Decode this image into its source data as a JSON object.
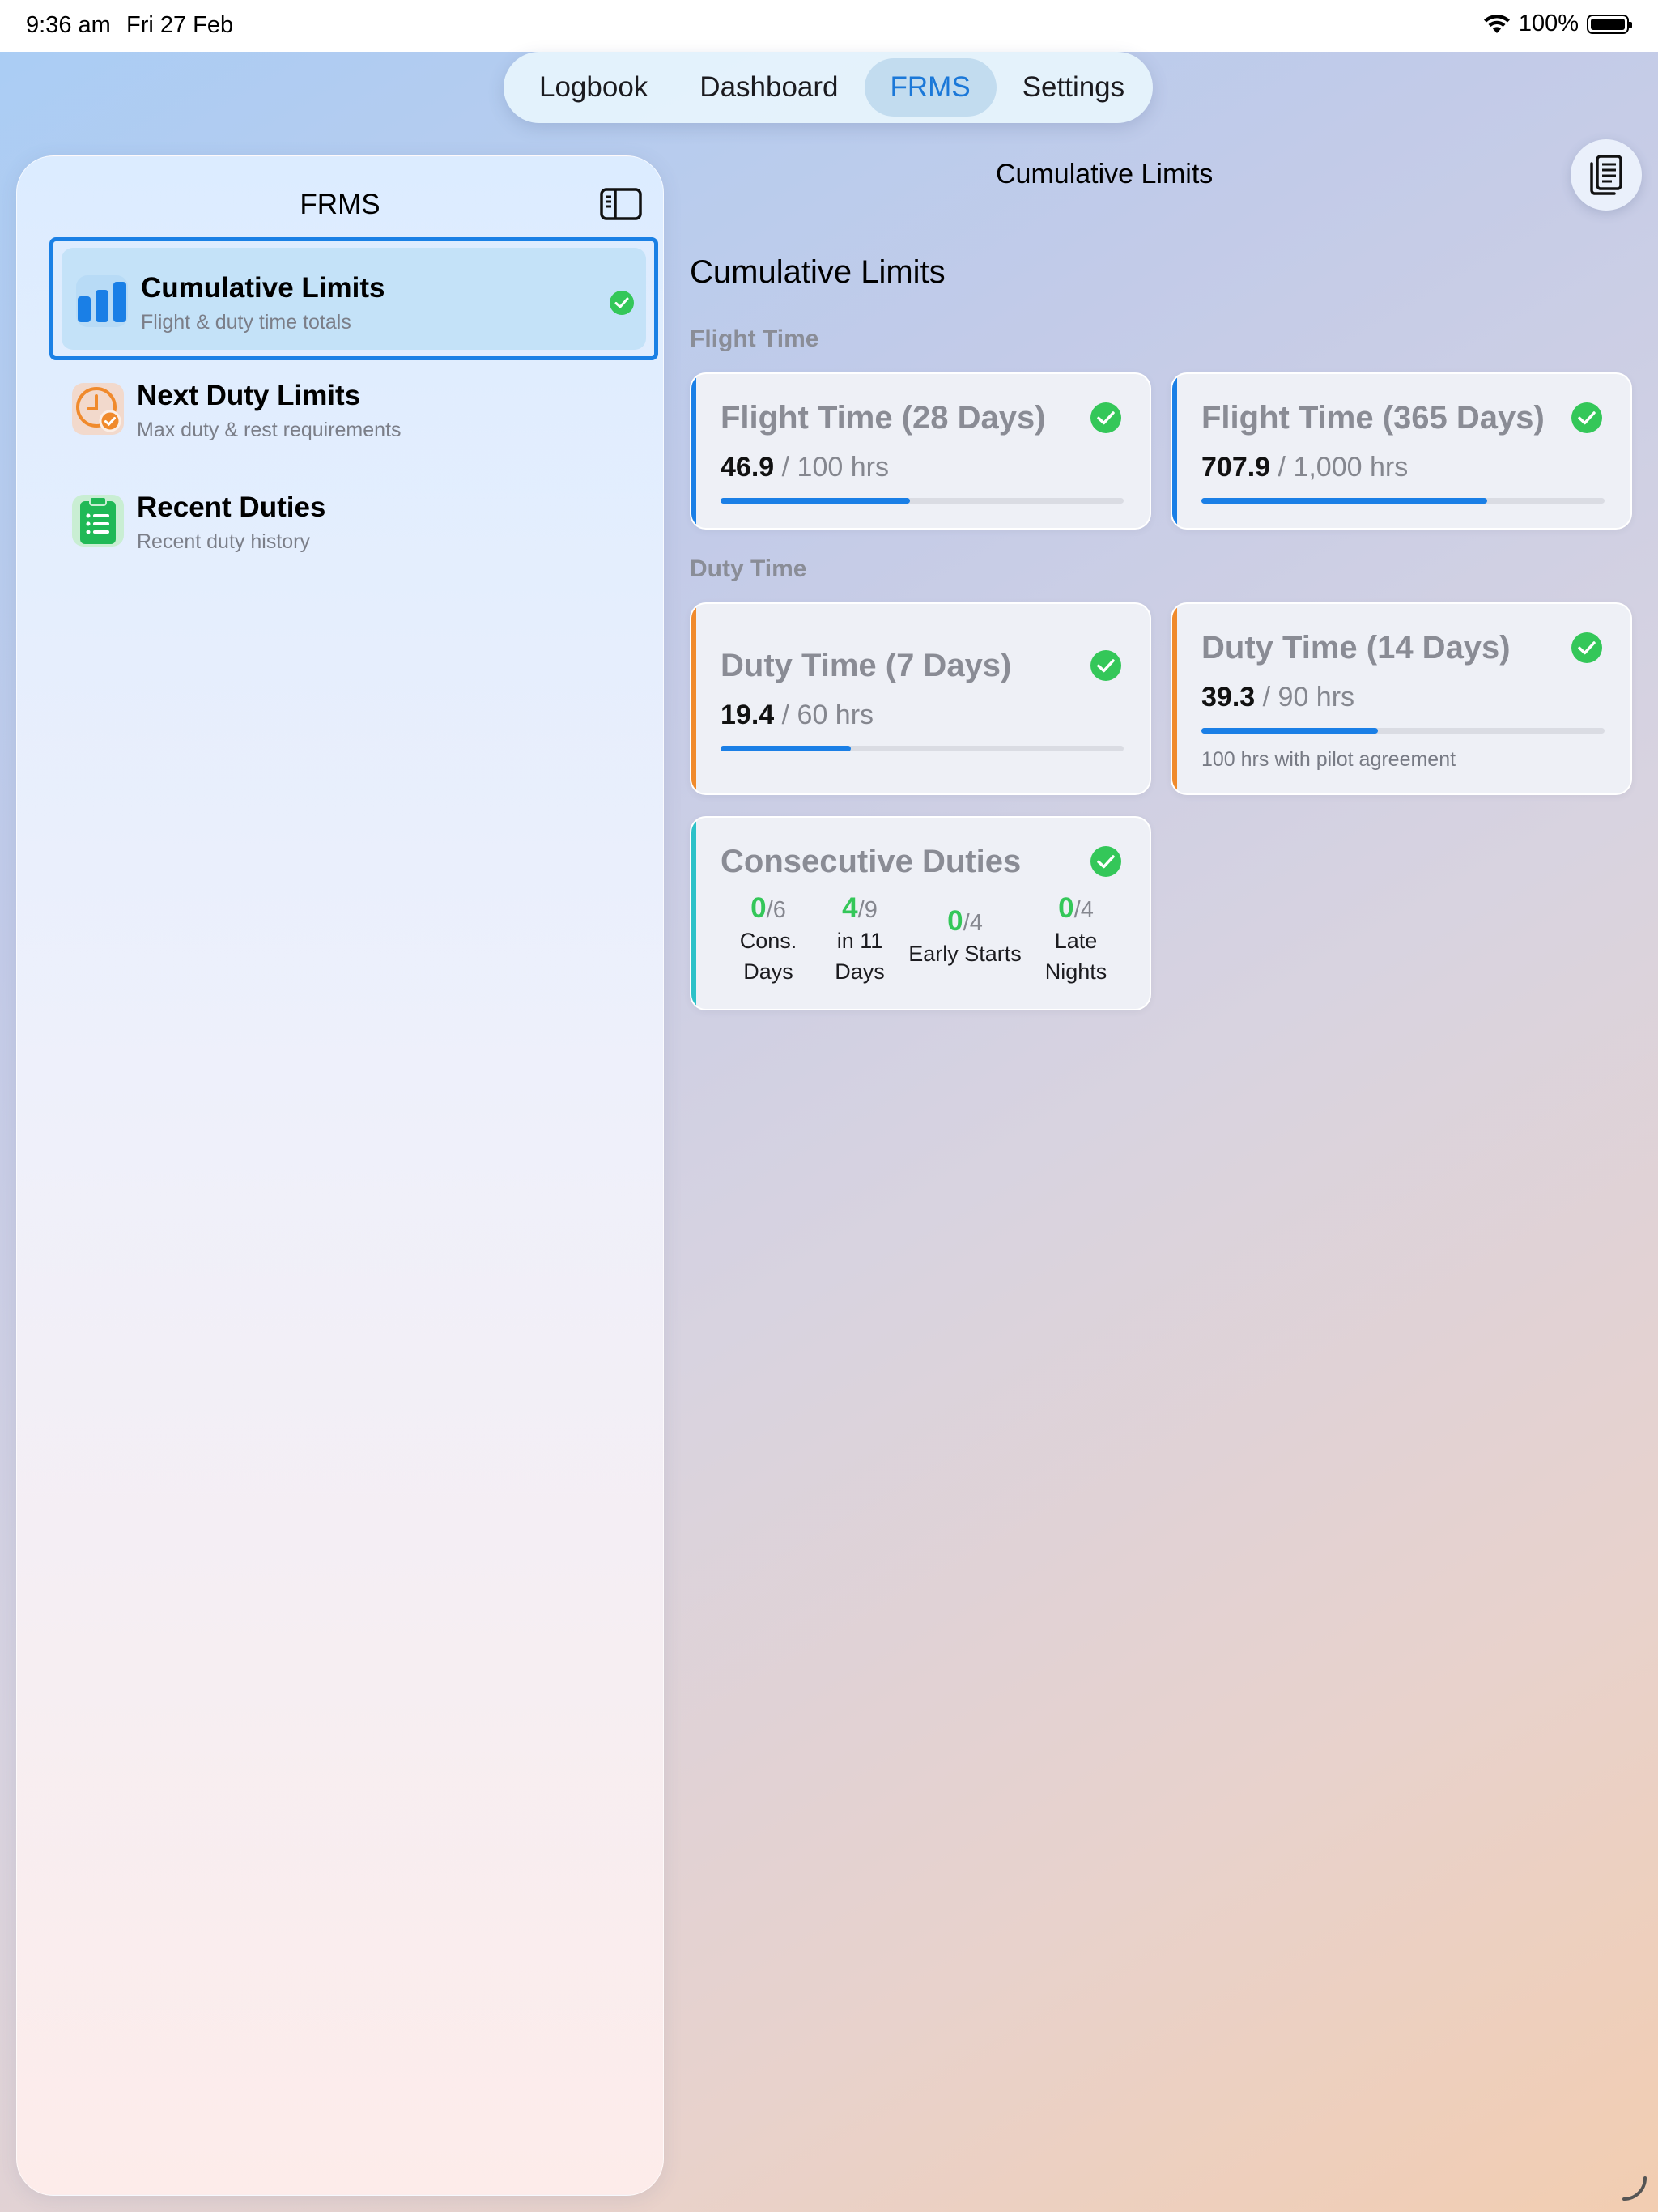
{
  "status": {
    "time": "9:36 am",
    "date": "Fri 27 Feb",
    "battery": "100%"
  },
  "tabs": [
    {
      "label": "Logbook",
      "active": false
    },
    {
      "label": "Dashboard",
      "active": false
    },
    {
      "label": "FRMS",
      "active": true
    },
    {
      "label": "Settings",
      "active": false
    }
  ],
  "sidebar": {
    "title": "FRMS",
    "items": [
      {
        "title": "Cumulative Limits",
        "subtitle": "Flight & duty time totals",
        "icon": "bar-chart-icon",
        "selected": true
      },
      {
        "title": "Next Duty Limits",
        "subtitle": "Max duty & rest requirements",
        "icon": "clock-badge-icon",
        "selected": false
      },
      {
        "title": "Recent Duties",
        "subtitle": "Recent duty history",
        "icon": "clipboard-icon",
        "selected": false
      }
    ]
  },
  "main": {
    "nav_title": "Cumulative Limits",
    "heading": "Cumulative Limits",
    "sections": {
      "flight": "Flight Time",
      "duty": "Duty Time"
    },
    "cards": {
      "flight28": {
        "title": "Flight Time (28 Days)",
        "value": "46.9",
        "limit": "/ 100 hrs",
        "progress": 0.469
      },
      "flight365": {
        "title": "Flight Time (365 Days)",
        "value": "707.9",
        "limit": "/ 1,000 hrs",
        "progress": 0.708
      },
      "duty7": {
        "title": "Duty Time (7 Days)",
        "value": "19.4",
        "limit": "/ 60 hrs",
        "progress": 0.323
      },
      "duty14": {
        "title": "Duty Time (14 Days)",
        "value": "39.3",
        "limit": "/ 90 hrs",
        "progress": 0.437,
        "note": "100 hrs with pilot agreement"
      },
      "consecutive": {
        "title": "Consecutive Duties",
        "stats": [
          {
            "value": "0",
            "max": "/6",
            "label1": "Cons.",
            "label2": "Days"
          },
          {
            "value": "4",
            "max": "/9",
            "label1": "in 11",
            "label2": "Days"
          },
          {
            "value": "0",
            "max": "/4",
            "label1": "Early Starts",
            "label2": ""
          },
          {
            "value": "0",
            "max": "/4",
            "label1": "Late",
            "label2": "Nights"
          }
        ]
      }
    }
  },
  "colors": {
    "accent": "#1a7fe6",
    "success": "#34c759",
    "flight_bar": "#1a7fe6",
    "duty_bar": "#f08a2c",
    "consec_bar": "#2cc1c8"
  }
}
